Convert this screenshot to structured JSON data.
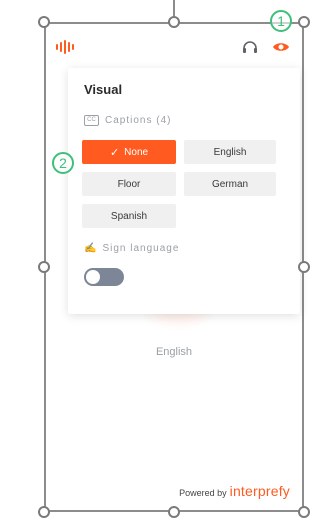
{
  "header": {
    "logo_icon": "interprefy-waveform-icon",
    "actions": [
      {
        "icon": "headphones-icon"
      },
      {
        "icon": "eye-icon",
        "color": "#ff5a1f"
      }
    ]
  },
  "panel": {
    "title": "Visual",
    "captions": {
      "icon": "cc-icon",
      "icon_text": "CC",
      "label": "Captions (4)"
    },
    "options": [
      {
        "label": "None",
        "selected": true
      },
      {
        "label": "English",
        "selected": false
      },
      {
        "label": "Floor",
        "selected": false
      },
      {
        "label": "German",
        "selected": false
      },
      {
        "label": "Spanish",
        "selected": false
      }
    ],
    "sign_language": {
      "icon": "sign-language-icon",
      "icon_text": "✍",
      "label": "Sign language",
      "enabled": false
    }
  },
  "background": {
    "language_label": "English"
  },
  "footer": {
    "powered_by": "Powered by",
    "brand": "interprefy"
  },
  "annotations": [
    {
      "label": "1"
    },
    {
      "label": "2"
    }
  ],
  "colors": {
    "accent": "#ff5a1f",
    "callout": "#3fbf7a",
    "toggle_off": "#7d8697"
  }
}
